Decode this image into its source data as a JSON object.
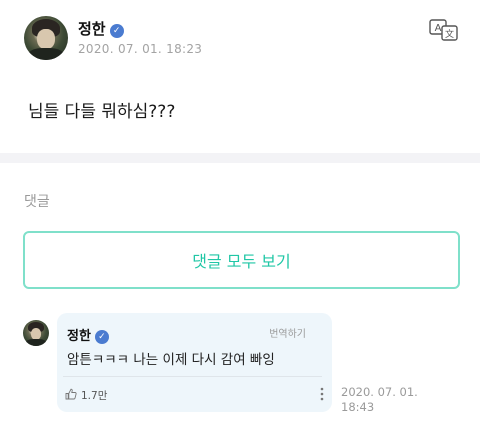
{
  "post": {
    "author": "정한",
    "timestamp": "2020. 07. 01. 18:23",
    "body": "님들 다들 뭐하심???",
    "verified_icon": "check-badge-icon",
    "translate_icon": "translate-icon"
  },
  "comments_section": {
    "heading": "댓글",
    "view_all_label": "댓글 모두 보기"
  },
  "comment": {
    "author": "정한",
    "translate_label": "번역하기",
    "text": "암튼ㅋㅋㅋ 나는 이제 다시 감여 빠잉",
    "likes": "1.7만",
    "timestamp": "2020. 07. 01. 18:43"
  },
  "colors": {
    "accent": "#20c7a6",
    "accent_border": "#7fe0ca",
    "verified": "#4a7bd0",
    "comment_bg": "#eef6fb"
  }
}
